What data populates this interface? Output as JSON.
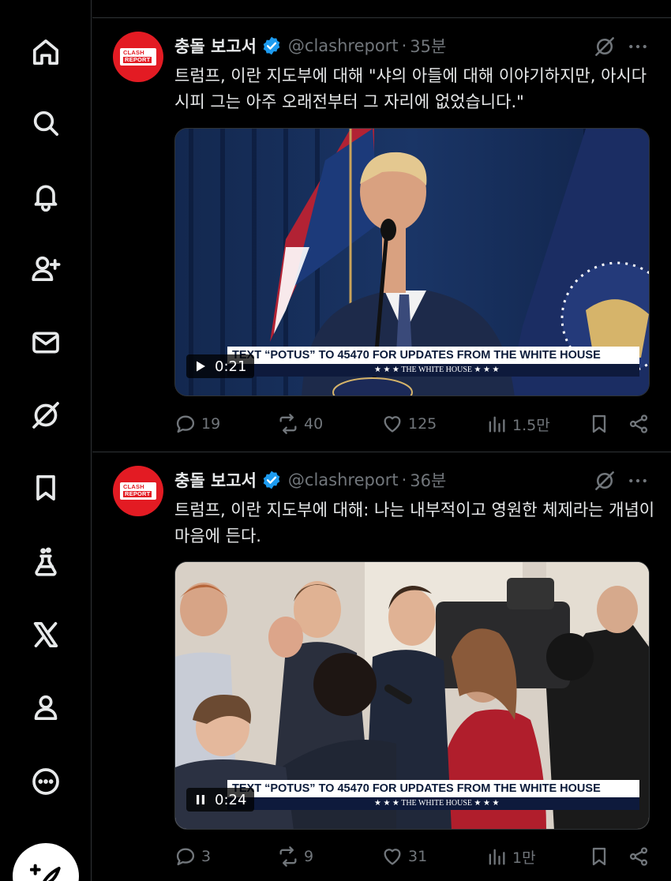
{
  "sidebar": {
    "items": [
      {
        "name": "home",
        "icon": "home-icon"
      },
      {
        "name": "explore",
        "icon": "search-icon"
      },
      {
        "name": "notifications",
        "icon": "bell-icon"
      },
      {
        "name": "follow",
        "icon": "add-user-icon"
      },
      {
        "name": "messages",
        "icon": "mail-icon"
      },
      {
        "name": "grok",
        "icon": "grok-icon"
      },
      {
        "name": "bookmarks",
        "icon": "bookmark-icon"
      },
      {
        "name": "labs",
        "icon": "flask-icon"
      },
      {
        "name": "premium",
        "icon": "x-logo-icon"
      },
      {
        "name": "profile",
        "icon": "person-icon"
      },
      {
        "name": "more",
        "icon": "more-circle-icon"
      }
    ],
    "compose_icon": "compose-feather-icon"
  },
  "tweets": [
    {
      "author": "충돌 보고서",
      "handle": "@clashreport",
      "dot": "·",
      "time": "35분",
      "avatar_text": {
        "line1": "CLASH",
        "line2": "REPORT"
      },
      "text": "트럼프, 이란 지도부에 대해 \"샤의 아들에 대해 이야기하지만, 아시다시피 그는 아주 오래전부터 그 자리에 없었습니다.\"",
      "video": {
        "banner": "TEXT “POTUS” TO 45470 FOR UPDATES FROM THE WHITE HOUSE",
        "sub_banner": "★ ★ ★  THE WHITE HOUSE  ★ ★ ★",
        "state": "play",
        "timestamp": "0:21"
      },
      "stats": {
        "replies": "19",
        "reposts": "40",
        "likes": "125",
        "views": "1.5만"
      }
    },
    {
      "author": "충돌 보고서",
      "handle": "@clashreport",
      "dot": "·",
      "time": "36분",
      "avatar_text": {
        "line1": "CLASH",
        "line2": "REPORT"
      },
      "text": "트럼프, 이란 지도부에 대해: 나는 내부적이고 영원한 체제라는 개념이 마음에 든다.",
      "video": {
        "banner": "TEXT “POTUS” TO 45470 FOR UPDATES FROM THE WHITE HOUSE",
        "sub_banner": "★ ★ ★  THE WHITE HOUSE  ★ ★ ★",
        "state": "pause",
        "timestamp": "0:24"
      },
      "stats": {
        "replies": "3",
        "reposts": "9",
        "likes": "31",
        "views": "1만"
      }
    }
  ],
  "colors": {
    "background": "#000000",
    "text": "#e7e9ea",
    "muted": "#71767b",
    "border": "#2f3336",
    "verified": "#1d9bf0",
    "brand_red": "#e31b23"
  }
}
